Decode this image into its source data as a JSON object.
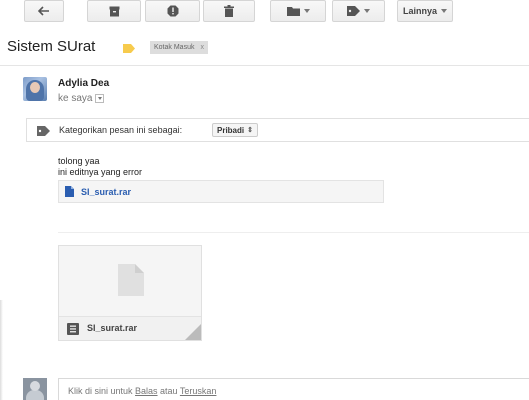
{
  "toolbar": {
    "lainnya_label": "Lainnya"
  },
  "subject": {
    "title": "Sistem SUrat",
    "label_chip": "Kotak Masuk",
    "label_remove": "x",
    "importance_color": "#f7cb4d"
  },
  "message": {
    "sender_name": "Adylia Dea",
    "to_me": "ke saya",
    "categorize_text": "Kategorikan pesan ini sebagai:",
    "category_value": "Pribadi",
    "body_line1": "tolong yaa",
    "body_line2": "ini editnya yang error",
    "inline_attachment": "SI_surat.rar",
    "attachment_card_name": "SI_surat.rar"
  },
  "reply": {
    "prefix": "Klik di sini untuk ",
    "reply_link": "Balas",
    "middle": " atau ",
    "forward_link": "Teruskan"
  },
  "colors": {
    "link": "#2a5db0",
    "chip_bg": "#dddddd"
  }
}
